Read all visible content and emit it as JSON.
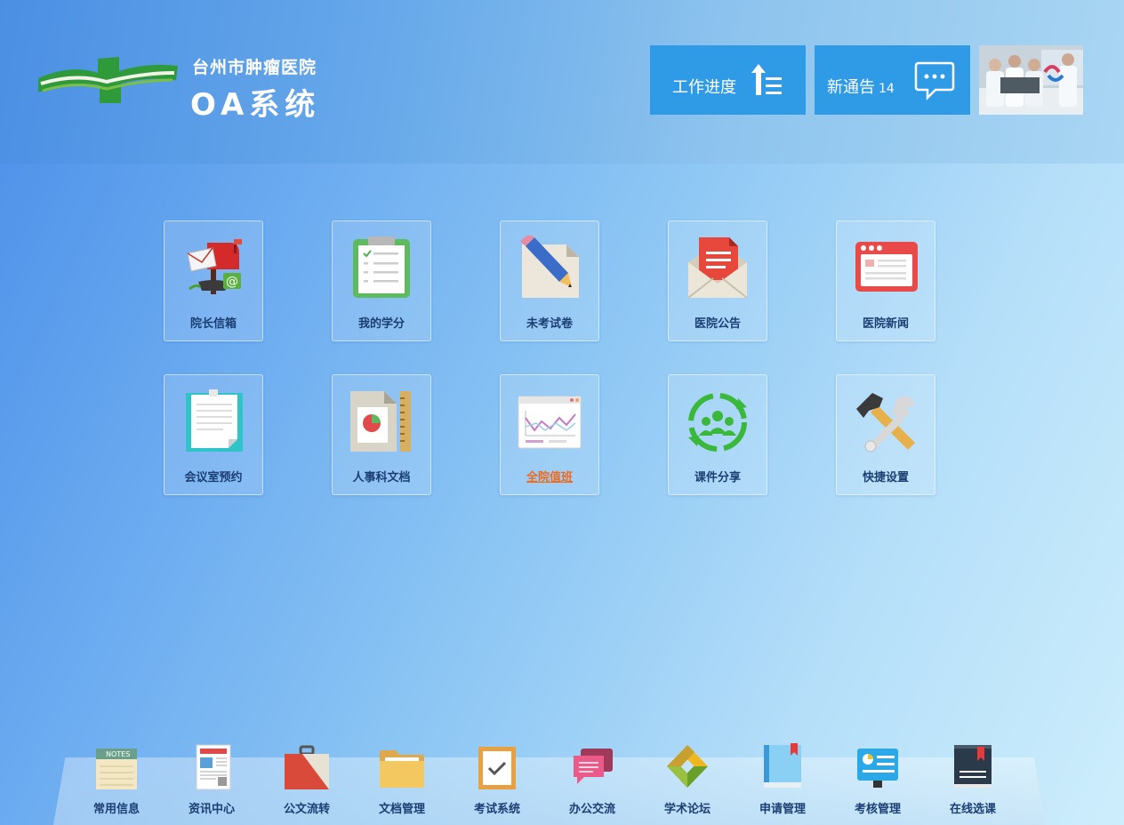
{
  "header": {
    "logo_name": "台州市肿瘤医院",
    "system_title": "OA系统",
    "progress_button": "工作进度",
    "notice_button": "新通告",
    "notice_count": "14"
  },
  "colors": {
    "accent": "#2f9ae6",
    "label": "#1b3e73",
    "active_link": "#f06a1e"
  },
  "tiles": [
    {
      "label": "院长信箱",
      "icon": "mailbox-icon"
    },
    {
      "label": "我的学分",
      "icon": "clipboard-icon"
    },
    {
      "label": "未考试卷",
      "icon": "pencil-paper-icon"
    },
    {
      "label": "医院公告",
      "icon": "envelope-letter-icon"
    },
    {
      "label": "医院新闻",
      "icon": "browser-window-icon"
    },
    {
      "label": "会议室预约",
      "icon": "notepad-icon"
    },
    {
      "label": "人事科文档",
      "icon": "document-ruler-icon"
    },
    {
      "label": "全院值班",
      "icon": "line-chart-icon"
    },
    {
      "label": "课件分享",
      "icon": "users-cycle-icon"
    },
    {
      "label": "快捷设置",
      "icon": "hammer-wrench-icon"
    }
  ],
  "dock": [
    {
      "label": "常用信息",
      "icon": "notes-icon"
    },
    {
      "label": "资讯中心",
      "icon": "newspaper-icon"
    },
    {
      "label": "公文流转",
      "icon": "briefcase-icon"
    },
    {
      "label": "文档管理",
      "icon": "folder-icon"
    },
    {
      "label": "考试系统",
      "icon": "checklist-icon"
    },
    {
      "label": "办公交流",
      "icon": "chat-bubbles-icon"
    },
    {
      "label": "学术论坛",
      "icon": "forum-icon"
    },
    {
      "label": "申请管理",
      "icon": "bookmark-book-icon"
    },
    {
      "label": "考核管理",
      "icon": "id-card-icon"
    },
    {
      "label": "在线选课",
      "icon": "book-icon"
    }
  ]
}
